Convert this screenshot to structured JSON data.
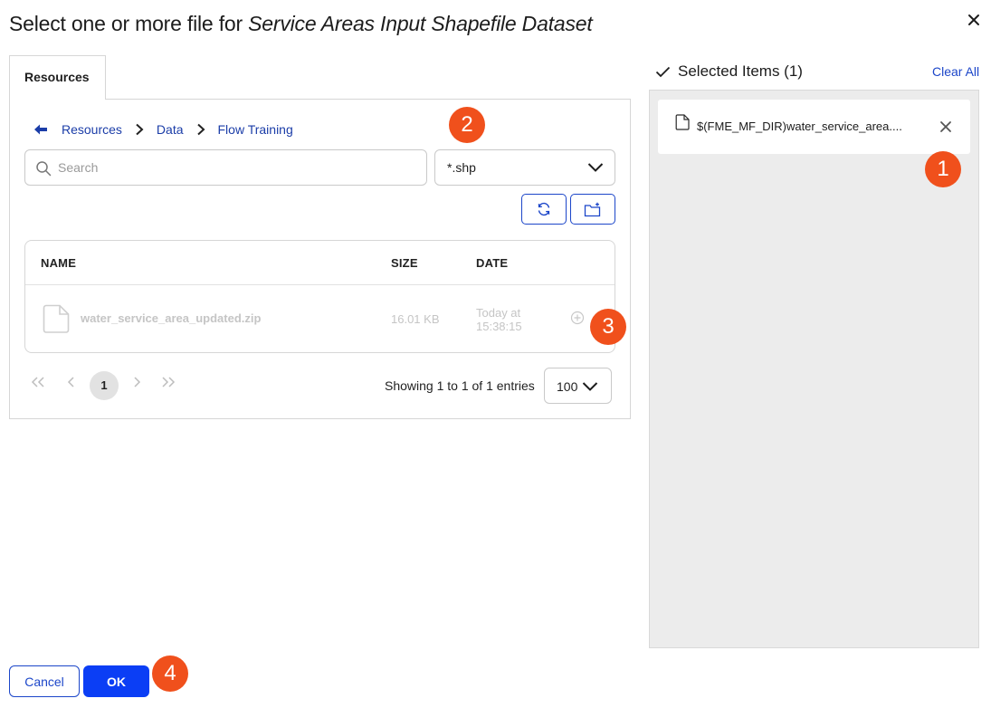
{
  "dialog": {
    "title_prefix": "Select one or more file for ",
    "title_dataset": "Service Areas Input Shapefile Dataset"
  },
  "tabs": [
    {
      "label": "Resources",
      "active": true
    }
  ],
  "breadcrumb": [
    "Resources",
    "Data",
    "Flow Training"
  ],
  "search": {
    "placeholder": "Search",
    "value": ""
  },
  "filter": {
    "value": "*.shp"
  },
  "table": {
    "headers": {
      "name": "NAME",
      "size": "SIZE",
      "date": "DATE"
    },
    "rows": [
      {
        "name": "water_service_area_updated.zip",
        "size": "16.01 KB",
        "date": "Today at 15:38:15"
      }
    ]
  },
  "pagination": {
    "current_page": "1",
    "showing": "Showing 1 to 1 of 1 entries",
    "page_size": "100"
  },
  "selected": {
    "header": "Selected Items (1)",
    "clear_all": "Clear All",
    "items": [
      {
        "path": "$(FME_MF_DIR)water_service_area...."
      }
    ]
  },
  "buttons": {
    "cancel": "Cancel",
    "ok": "OK"
  },
  "callouts": [
    "1",
    "2",
    "3",
    "4"
  ],
  "colors": {
    "accent": "#1c46c9",
    "primary": "#0b3ef5",
    "callout": "#f0501c"
  },
  "icons": [
    "close-icon",
    "back-arrow-icon",
    "chevron-right-icon",
    "search-icon",
    "chevron-down-icon",
    "refresh-icon",
    "new-folder-icon",
    "file-icon",
    "add-circle-icon",
    "checkmark-icon",
    "remove-icon"
  ]
}
